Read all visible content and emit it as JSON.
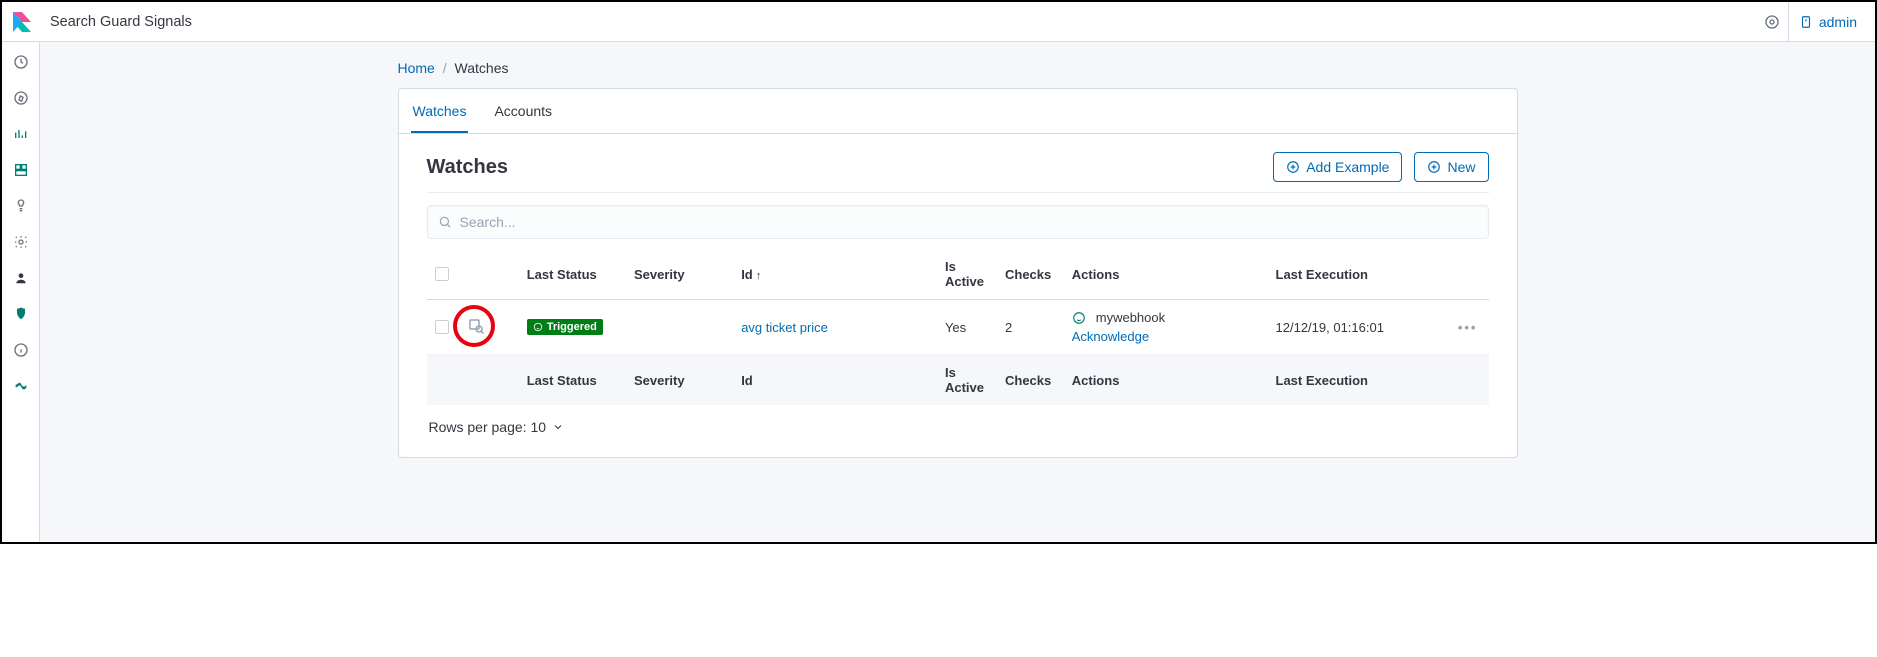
{
  "header": {
    "app_title": "Search Guard Signals",
    "user": "admin"
  },
  "breadcrumbs": {
    "home": "Home",
    "current": "Watches"
  },
  "tabs": [
    {
      "label": "Watches",
      "active": true
    },
    {
      "label": "Accounts",
      "active": false
    }
  ],
  "section": {
    "title": "Watches",
    "add_example": "Add Example",
    "new": "New",
    "search_placeholder": "Search...",
    "rows_per_page": "Rows per page: 10"
  },
  "columns": {
    "last_status": "Last Status",
    "severity": "Severity",
    "id": "Id",
    "is_active": "Is Active",
    "checks": "Checks",
    "actions": "Actions",
    "last_execution": "Last Execution"
  },
  "rows": [
    {
      "status_label": "Triggered",
      "status_color": "#017d16",
      "severity": "",
      "id": "avg ticket price",
      "is_active": "Yes",
      "checks": "2",
      "action_name": "mywebhook",
      "acknowledge": "Acknowledge",
      "last_execution": "12/12/19, 01:16:01"
    }
  ]
}
